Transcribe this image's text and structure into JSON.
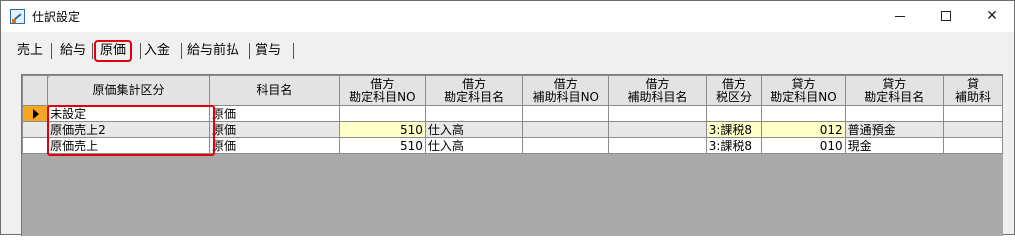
{
  "window": {
    "title": "仕訳設定",
    "icon": "journal-settings-icon"
  },
  "tabs": [
    {
      "label": "売上",
      "active": false
    },
    {
      "label": "給与",
      "active": false
    },
    {
      "label": "原価",
      "active": true
    },
    {
      "label": "入金",
      "active": false
    },
    {
      "label": "給与前払",
      "active": false
    },
    {
      "label": "賞与",
      "active": false
    }
  ],
  "grid": {
    "columns": [
      {
        "line1": "原価集計区分",
        "line2": ""
      },
      {
        "line1": "科目名",
        "line2": ""
      },
      {
        "line1": "借方",
        "line2": "勘定科目NO"
      },
      {
        "line1": "借方",
        "line2": "勘定科目名"
      },
      {
        "line1": "借方",
        "line2": "補助科目NO"
      },
      {
        "line1": "借方",
        "line2": "補助科目名"
      },
      {
        "line1": "借方",
        "line2": "税区分"
      },
      {
        "line1": "貸方",
        "line2": "勘定科目NO"
      },
      {
        "line1": "貸方",
        "line2": "勘定科目名"
      },
      {
        "line1": "貸",
        "line2": "補助科"
      }
    ],
    "rows": [
      {
        "category": "未設定",
        "subject": "原価",
        "debit_no": "",
        "debit_name": "",
        "debit_sub_no": "",
        "debit_sub_name": "",
        "debit_tax": "",
        "credit_no": "",
        "credit_name": "",
        "credit_sub": ""
      },
      {
        "category": "原価売上2",
        "subject": "原価",
        "debit_no": "510",
        "debit_name": "仕入高",
        "debit_sub_no": "",
        "debit_sub_name": "",
        "debit_tax": "3:課税8",
        "credit_no": "012",
        "credit_name": "普通預金",
        "credit_sub": ""
      },
      {
        "category": "原価売上",
        "subject": "原価",
        "debit_no": "510",
        "debit_name": "仕入高",
        "debit_sub_no": "",
        "debit_sub_name": "",
        "debit_tax": "3:課税8",
        "credit_no": "010",
        "credit_name": "現金",
        "credit_sub": ""
      }
    ]
  },
  "colors": {
    "highlight_header": "#ff8000",
    "annotation_red": "#e0000f",
    "current_row_marker": "#f5a623",
    "yellow_cell": "#ffffc8"
  }
}
